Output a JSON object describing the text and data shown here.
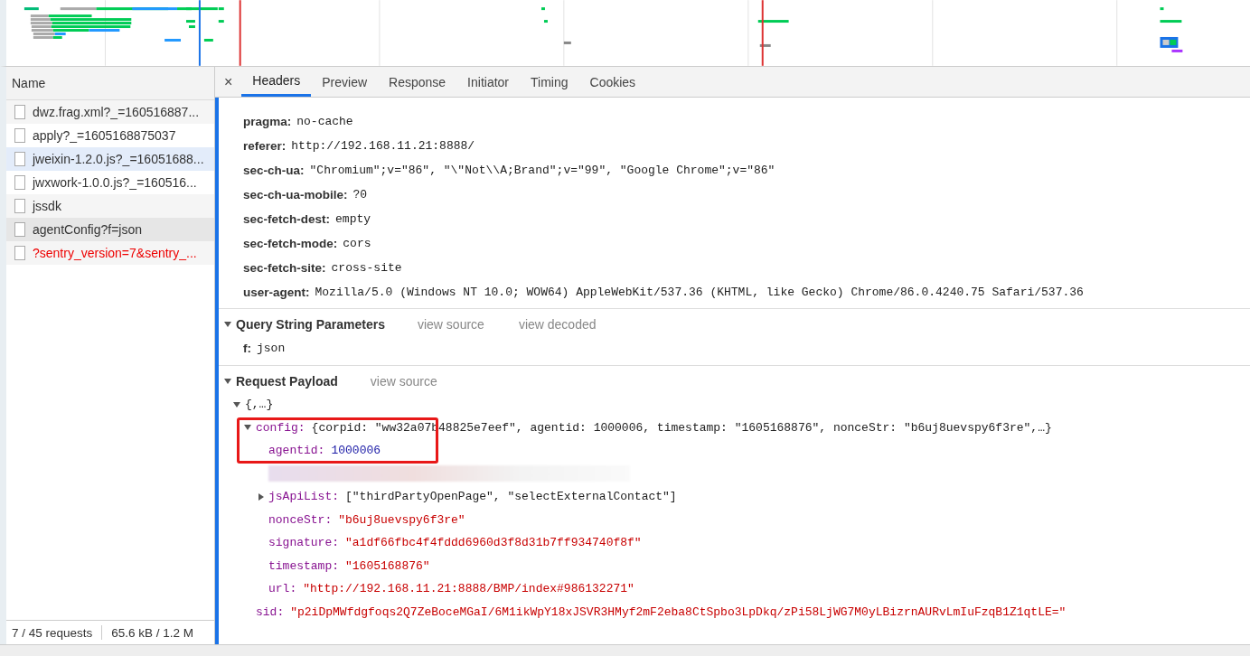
{
  "requests": {
    "column": "Name",
    "items": [
      {
        "name": "dwz.frag.xml?_=160516887...",
        "selected": false,
        "hovered": false,
        "failed": false
      },
      {
        "name": "apply?_=1605168875037",
        "selected": false,
        "hovered": false,
        "failed": false
      },
      {
        "name": "jweixin-1.2.0.js?_=16051688...",
        "selected": false,
        "hovered": true,
        "failed": false
      },
      {
        "name": "jwxwork-1.0.0.js?_=160516...",
        "selected": false,
        "hovered": false,
        "failed": false
      },
      {
        "name": "jssdk",
        "selected": false,
        "hovered": false,
        "failed": false
      },
      {
        "name": "agentConfig?f=json",
        "selected": true,
        "hovered": false,
        "failed": false
      },
      {
        "name": "?sentry_version=7&sentry_...",
        "selected": false,
        "hovered": false,
        "failed": true
      }
    ],
    "summary": "7 / 45 requests",
    "transfer": "65.6 kB / 1.2 M"
  },
  "detail": {
    "close": "×",
    "tabs": [
      {
        "label": "Headers",
        "selected": true
      },
      {
        "label": "Preview",
        "selected": false
      },
      {
        "label": "Response",
        "selected": false
      },
      {
        "label": "Initiator",
        "selected": false
      },
      {
        "label": "Timing",
        "selected": false
      },
      {
        "label": "Cookies",
        "selected": false
      }
    ],
    "headers": [
      {
        "name": "pragma:",
        "value": "no-cache"
      },
      {
        "name": "referer:",
        "value": "http://192.168.11.21:8888/"
      },
      {
        "name": "sec-ch-ua:",
        "value": "\"Chromium\";v=\"86\", \"\\\"Not\\\\A;Brand\";v=\"99\", \"Google Chrome\";v=\"86\""
      },
      {
        "name": "sec-ch-ua-mobile:",
        "value": "?0"
      },
      {
        "name": "sec-fetch-dest:",
        "value": "empty"
      },
      {
        "name": "sec-fetch-mode:",
        "value": "cors"
      },
      {
        "name": "sec-fetch-site:",
        "value": "cross-site"
      },
      {
        "name": "user-agent:",
        "value": "Mozilla/5.0 (Windows NT 10.0; WOW64) AppleWebKit/537.36 (KHTML, like Gecko) Chrome/86.0.4240.75 Safari/537.36"
      }
    ],
    "query": {
      "title": "Query String Parameters",
      "expanded": true,
      "links": [
        "view source",
        "view decoded"
      ],
      "params": [
        {
          "name": "f:",
          "value": "json"
        }
      ]
    },
    "payload": {
      "title": "Request Payload",
      "expanded": true,
      "links": [
        "view source"
      ],
      "tree": {
        "text": "{,…}",
        "expanded": true,
        "children": [
          {
            "kind": "object",
            "key": "config:",
            "value": "{corpid: \"ww32a07b48825e7eef\", agentid: 1000006, timestamp: \"1605168876\", nonceStr: \"b6uj8uevspy6f3re\",…}",
            "expanded": true,
            "children": [
              {
                "kind": "number",
                "key": "agentid:",
                "value": "1000006"
              },
              {
                "kind": "redacted"
              },
              {
                "kind": "array",
                "key": "jsApiList:",
                "value": "[\"thirdPartyOpenPage\", \"selectExternalContact\"]",
                "expanded": false
              },
              {
                "kind": "string",
                "key": "nonceStr:",
                "value": "\"b6uj8uevspy6f3re\""
              },
              {
                "kind": "string",
                "key": "signature:",
                "value": "\"a1df66fbc4f4fddd6960d3f8d31b7ff934740f8f\""
              },
              {
                "kind": "string",
                "key": "timestamp:",
                "value": "\"1605168876\""
              },
              {
                "kind": "string",
                "key": "url:",
                "value": "\"http://192.168.11.21:8888/BMP/index#986132271\""
              }
            ]
          },
          {
            "kind": "string",
            "key": "sid:",
            "value": "\"p2iDpMWfdgfoqs2Q7ZeBoceMGaI/6M1ikWpY18xJSVR3HMyf2mF2eba8CtSpbo3LpDkq/zPi58LjWG7M0yLBizrnAURvLmIuFzqB1Z1qtLE=\""
          }
        ]
      }
    }
  }
}
